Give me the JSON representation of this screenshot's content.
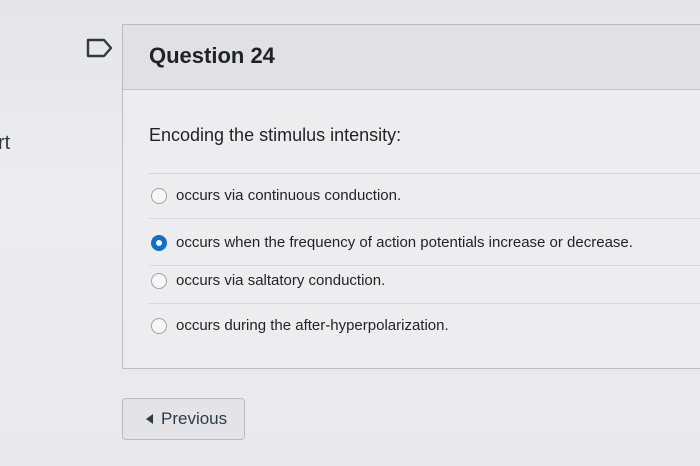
{
  "sidebar": {
    "partial_text": "rt"
  },
  "question": {
    "title": "Question 24",
    "text": "Encoding the stimulus intensity:",
    "answers": [
      {
        "label": "occurs via continuous conduction.",
        "selected": false
      },
      {
        "label": "occurs when the frequency of action potentials increase or decrease.",
        "selected": true
      },
      {
        "label": "occurs via saltatory conduction.",
        "selected": false
      },
      {
        "label": "occurs during the after-hyperpolarization.",
        "selected": false
      }
    ]
  },
  "navigation": {
    "previous_label": "Previous"
  },
  "icons": {
    "flag": "bookmark-flag-icon",
    "previous": "caret-left-icon"
  },
  "colors": {
    "selected_radio": "#1170c4",
    "text": "#1f2226"
  }
}
